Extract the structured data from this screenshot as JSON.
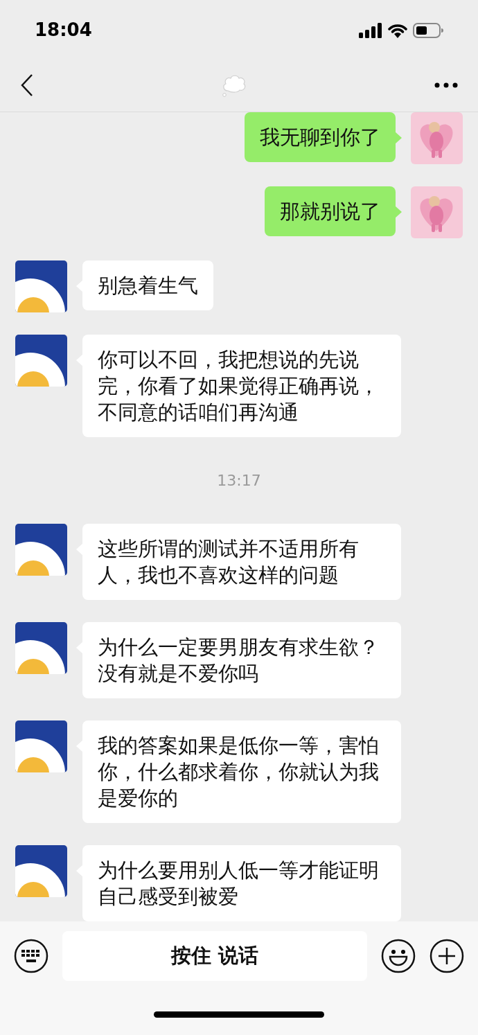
{
  "status_bar": {
    "time": "18:04"
  },
  "messages": [
    {
      "kind": "sent",
      "text": "我无聊到你了"
    },
    {
      "kind": "sent",
      "text": "那就别说了"
    },
    {
      "kind": "received",
      "text": "别急着生气"
    },
    {
      "kind": "received",
      "text": "你可以不回，我把想说的先说完，你看了如果觉得正确再说，不同意的话咱们再沟通"
    },
    {
      "kind": "time",
      "text": "13:17"
    },
    {
      "kind": "received",
      "text": "这些所谓的测试并不适用所有人，我也不喜欢这样的问题"
    },
    {
      "kind": "received",
      "text": "为什么一定要男朋友有求生欲？没有就是不爱你吗"
    },
    {
      "kind": "received",
      "text": "我的答案如果是低你一等，害怕你，什么都求着你，你就认为我是爱你的"
    },
    {
      "kind": "received",
      "text": "为什么要用别人低一等才能证明自己感受到被爱"
    }
  ],
  "input_bar": {
    "hold_to_talk": "按住 说话"
  }
}
